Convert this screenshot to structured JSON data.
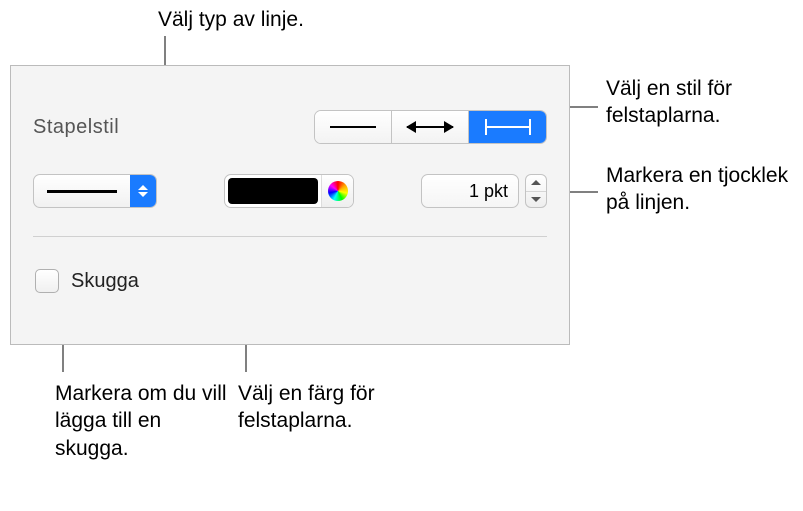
{
  "callouts": {
    "top": "Välj typ av linje.",
    "right_top": "Välj en stil för felstaplarna.",
    "right_mid": "Markera en tjocklek på linjen.",
    "bottom_left": "Markera om du vill lägga till en skugga.",
    "bottom_mid": "Välj en färg för felstaplarna."
  },
  "panel": {
    "section_label": "Stapelstil",
    "bar_styles": [
      "plain",
      "wide-ends",
      "capped"
    ],
    "thickness_value": "1 pkt",
    "shadow_label": "Skugga",
    "shadow_checked": false,
    "color_value": "#000000"
  }
}
